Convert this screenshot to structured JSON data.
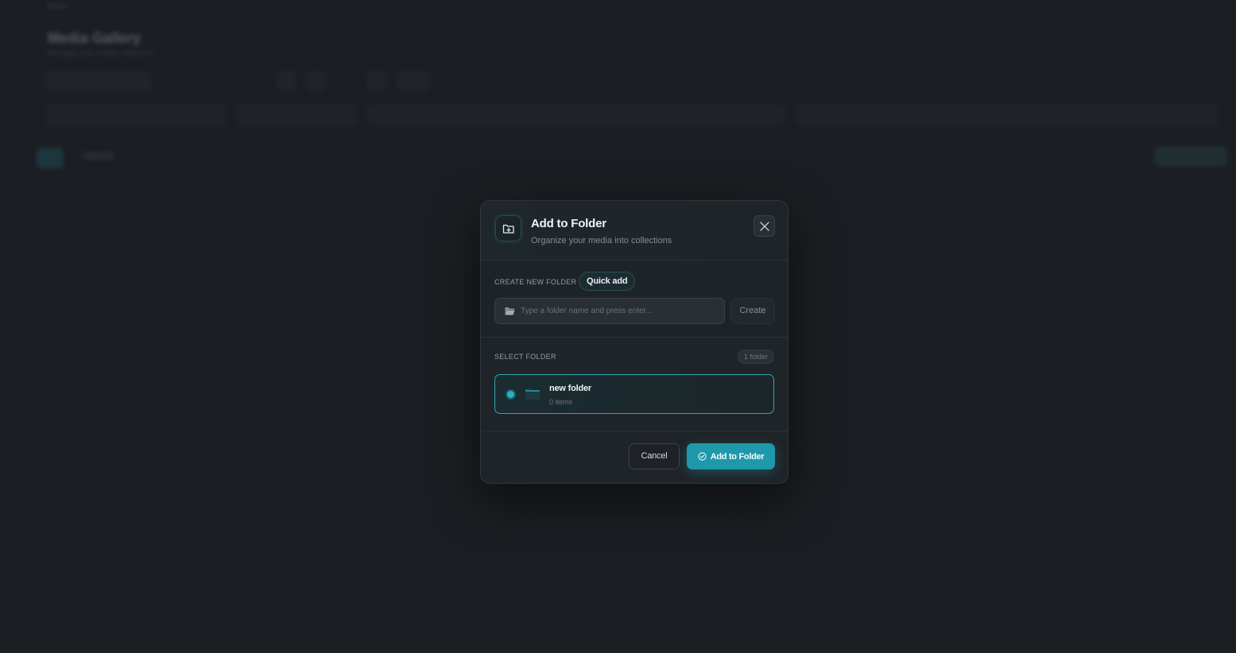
{
  "background": {
    "back_label": "Back",
    "page_title": "Media Gallery",
    "page_subtitle": "Manage your media collection"
  },
  "modal": {
    "title": "Add to Folder",
    "subtitle": "Organize your media into collections",
    "header_icon": "folder-plus-icon",
    "close_icon": "close-icon",
    "create_section": {
      "label": "CREATE NEW FOLDER",
      "badge": "Quick add",
      "input_placeholder": "Type a folder name and press enter...",
      "input_value": "",
      "input_icon": "folder-open-icon",
      "create_button": "Create"
    },
    "select_section": {
      "label": "SELECT FOLDER",
      "count_badge": "1 folder",
      "folders": [
        {
          "name": "new folder",
          "count": "0 items",
          "selected": true
        }
      ]
    },
    "footer": {
      "cancel_button": "Cancel",
      "submit_button": "Add to Folder",
      "submit_icon": "check-circle-icon"
    }
  },
  "colors": {
    "accent": "#1f98ab",
    "accent_border": "#2fa6b7",
    "background": "#1b1e22",
    "modal_bg": "#1f2428"
  }
}
